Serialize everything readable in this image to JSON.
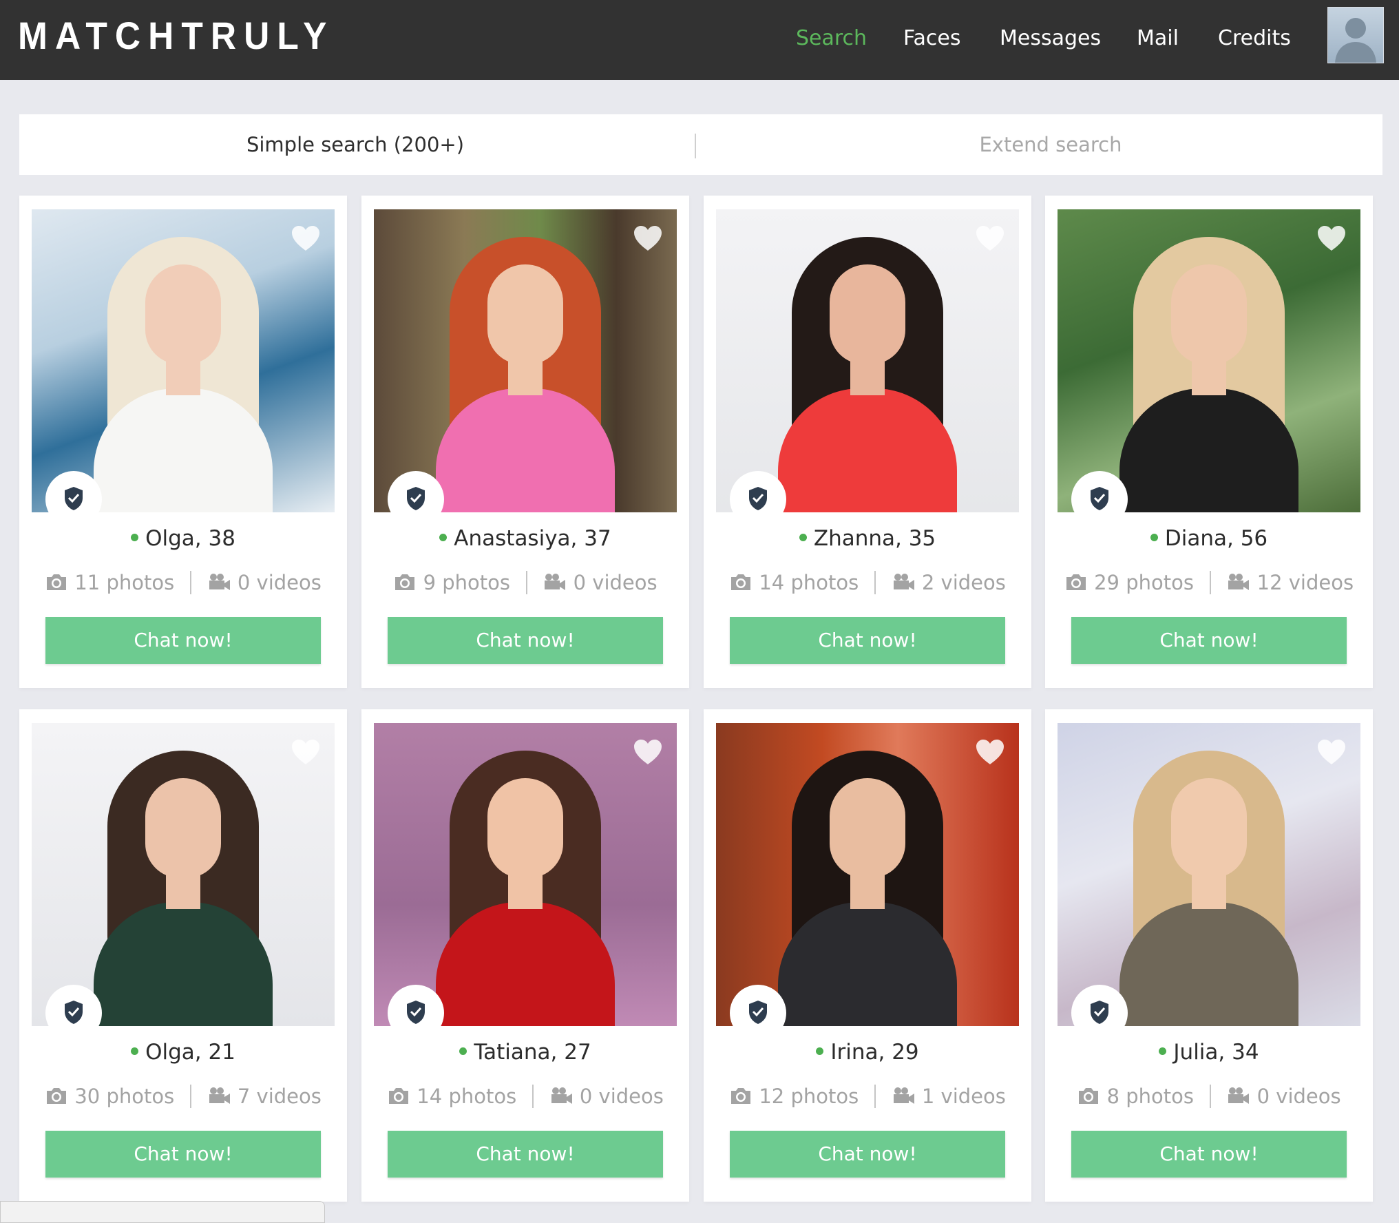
{
  "app": {
    "logo": "MATCHTRULY"
  },
  "nav": {
    "items": [
      {
        "label": "Search",
        "active": true
      },
      {
        "label": "Faces",
        "active": false
      },
      {
        "label": "Messages",
        "active": false
      },
      {
        "label": "Mail",
        "active": false
      },
      {
        "label": "Credits",
        "active": false
      }
    ]
  },
  "search": {
    "simple_label": "Simple search (200+)",
    "extend_label": "Extend search"
  },
  "colors": {
    "accent": "#5cb85c",
    "button": "#6dcb90",
    "online": "#4caf50",
    "topbar": "#323232"
  },
  "profiles": [
    {
      "name": "Olga, 38",
      "photos": "11 photos",
      "videos": "0 videos",
      "chat_label": "Chat now!",
      "online": true,
      "verified": true
    },
    {
      "name": "Anastasiya, 37",
      "photos": "9 photos",
      "videos": "0 videos",
      "chat_label": "Chat now!",
      "online": true,
      "verified": true
    },
    {
      "name": "Zhanna, 35",
      "photos": "14 photos",
      "videos": "2 videos",
      "chat_label": "Chat now!",
      "online": true,
      "verified": true
    },
    {
      "name": "Diana, 56",
      "photos": "29 photos",
      "videos": "12 videos",
      "chat_label": "Chat now!",
      "online": true,
      "verified": true
    },
    {
      "name": "Olga, 21",
      "photos": "30 photos",
      "videos": "7 videos",
      "chat_label": "Chat now!",
      "online": true,
      "verified": true
    },
    {
      "name": "Tatiana, 27",
      "photos": "14 photos",
      "videos": "0 videos",
      "chat_label": "Chat now!",
      "online": true,
      "verified": true
    },
    {
      "name": "Irina, 29",
      "photos": "12 photos",
      "videos": "1 videos",
      "chat_label": "Chat now!",
      "online": true,
      "verified": true
    },
    {
      "name": "Julia, 34",
      "photos": "8 photos",
      "videos": "0 videos",
      "chat_label": "Chat now!",
      "online": true,
      "verified": true
    }
  ],
  "icons": {
    "favorite": "heart-icon",
    "verified": "shield-check-icon",
    "photos": "camera-icon",
    "videos": "video-camera-icon"
  }
}
